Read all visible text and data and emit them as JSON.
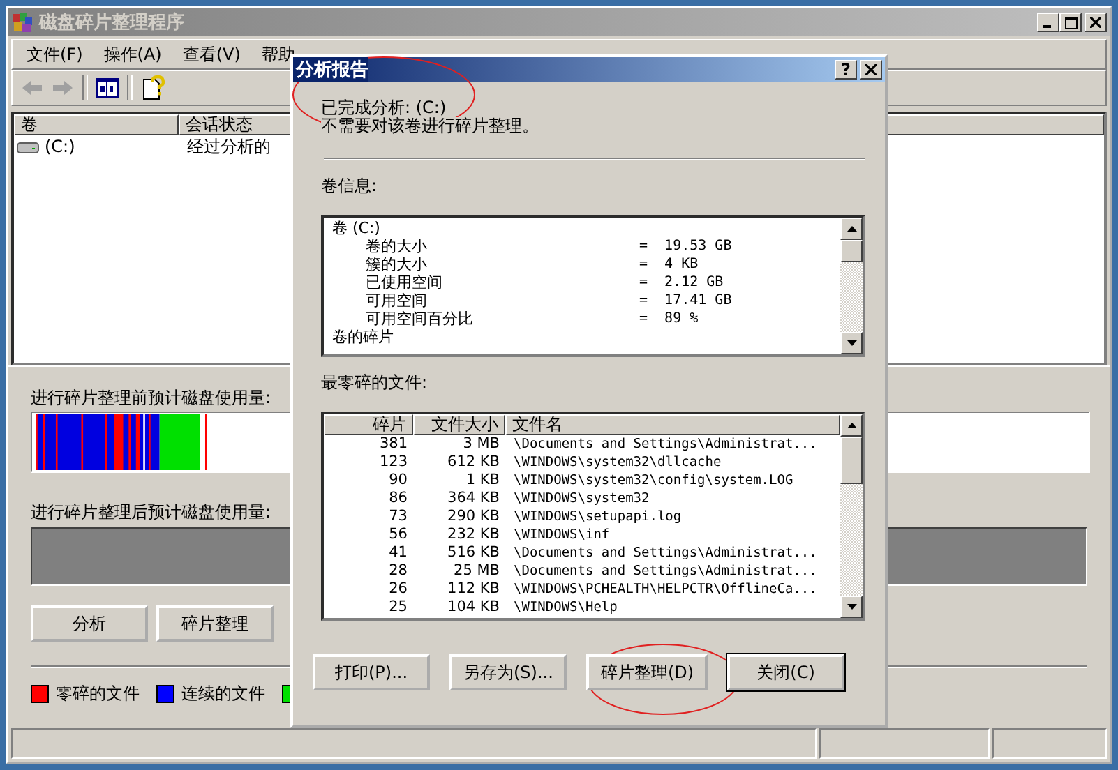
{
  "main_window": {
    "title": "磁盘碎片整理程序",
    "active": false
  },
  "menu": [
    "文件(F)",
    "操作(A)",
    "查看(V)",
    "帮助"
  ],
  "volume_list": {
    "columns": [
      "卷",
      "会话状态"
    ],
    "rows": [
      {
        "volume": "(C:)",
        "status": "经过分析的",
        "selected": false
      }
    ]
  },
  "before_label": "进行碎片整理前预计磁盘使用量:",
  "after_label": "进行碎片整理后预计磁盘使用量:",
  "main_buttons": [
    "分析",
    "碎片整理"
  ],
  "legend": [
    {
      "label": "零碎的文件",
      "color": "#ff0000"
    },
    {
      "label": "连续的文件",
      "color": "#0000ff"
    },
    {
      "color": "#00e000"
    }
  ],
  "dialog": {
    "title": "分析报告",
    "help_button": "?",
    "summary": "已完成分析: (C:)",
    "advice": "不需要对该卷进行碎片整理。",
    "volume_info_label": "卷信息:",
    "volume_info": [
      {
        "label": "卷  (C:)",
        "children": [
          {
            "label": "卷的大小",
            "value": "=  19.53 GB"
          },
          {
            "label": "簇的大小",
            "value": "=  4 KB"
          },
          {
            "label": "已使用空间",
            "value": "=  2.12 GB"
          },
          {
            "label": "可用空间",
            "value": "=  17.41 GB"
          },
          {
            "label": "可用空间百分比",
            "value": "=  89 %"
          }
        ]
      },
      {
        "label": "卷的碎片"
      }
    ],
    "files_label": "最零碎的文件:",
    "files_columns": [
      "碎片",
      "文件大小",
      "文件名"
    ],
    "files": [
      {
        "fragments": "381",
        "size": "3 MB",
        "name": "\\Documents and Settings\\Administrat..."
      },
      {
        "fragments": "123",
        "size": "612 KB",
        "name": "\\WINDOWS\\system32\\dllcache"
      },
      {
        "fragments": "90",
        "size": "1 KB",
        "name": "\\WINDOWS\\system32\\config\\system.LOG"
      },
      {
        "fragments": "86",
        "size": "364 KB",
        "name": "\\WINDOWS\\system32"
      },
      {
        "fragments": "73",
        "size": "290 KB",
        "name": "\\WINDOWS\\setupapi.log"
      },
      {
        "fragments": "56",
        "size": "232 KB",
        "name": "\\WINDOWS\\inf"
      },
      {
        "fragments": "41",
        "size": "516 KB",
        "name": "\\Documents and Settings\\Administrat..."
      },
      {
        "fragments": "28",
        "size": "25 MB",
        "name": "\\Documents and Settings\\Administrat..."
      },
      {
        "fragments": "26",
        "size": "112 KB",
        "name": "\\WINDOWS\\PCHEALTH\\HELPCTR\\OfflineCa..."
      },
      {
        "fragments": "25",
        "size": "104 KB",
        "name": "\\WINDOWS\\Help"
      }
    ],
    "buttons": [
      {
        "label": "打印(P)...",
        "default": false
      },
      {
        "label": "另存为(S)...",
        "default": false
      },
      {
        "label": "碎片整理(D)",
        "default": false
      },
      {
        "label": "关闭(C)",
        "default": true
      }
    ]
  }
}
